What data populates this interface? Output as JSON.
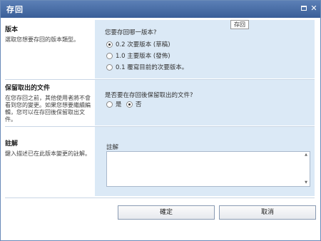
{
  "window": {
    "title": "存回",
    "maximize_icon": "maximize-icon",
    "close_icon": "close-icon",
    "close_glyph": "✕"
  },
  "tooltip": "存回",
  "version": {
    "heading": "版本",
    "description": "選取您想要存回的版本類型。",
    "question": "您要存回哪一版本?",
    "options": [
      {
        "label": "0.2 次要版本 (草稿)",
        "checked": true
      },
      {
        "label": "1.0 主要版本 (發佈)",
        "checked": false
      },
      {
        "label": "0.1 覆寫目前的次要版本。",
        "checked": false
      }
    ]
  },
  "keep_checked_out": {
    "heading": "保留取出的文件",
    "description": "在您存回之前，其他使用者將不會看到您的變更。如果您想要繼續編輯，您可以在存回後保留取出文件。",
    "question": "是否要在存回後保留取出的文件?",
    "yes_label": "是",
    "no_label": "否",
    "selected": "否"
  },
  "comments": {
    "heading": "註解",
    "description": "鍵入描述已在此版本變更的註解。",
    "field_label": "註解",
    "value": ""
  },
  "buttons": {
    "ok": "確定",
    "cancel": "取消"
  }
}
